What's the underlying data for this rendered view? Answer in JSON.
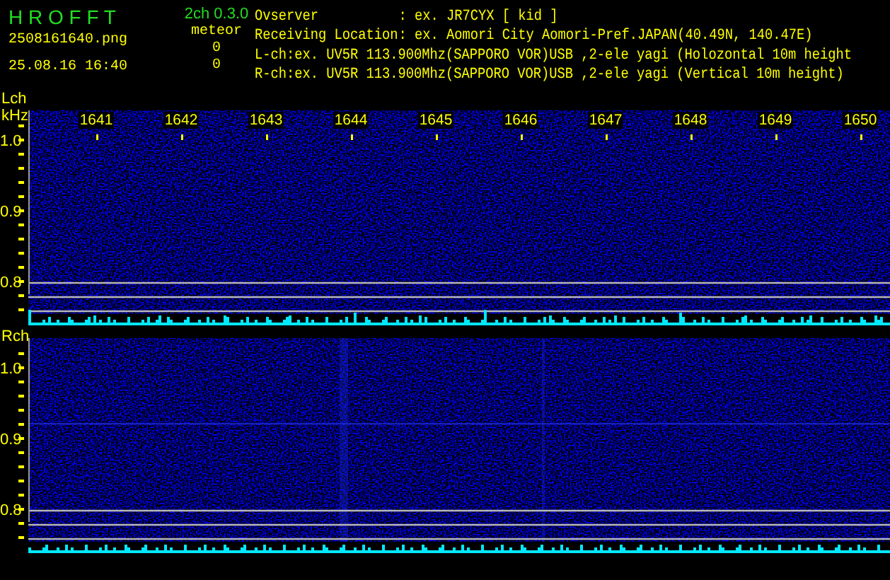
{
  "app": {
    "logo": "H R O F F T",
    "version": "2ch 0.3.0",
    "file": "2508161640.png",
    "datetime": "25.08.16 16:40"
  },
  "meteor": {
    "label": "meteor",
    "counts": [
      "0",
      "0"
    ]
  },
  "info": [
    {
      "label": "Ovserver",
      "value": ": ex. JR7CYX [ kid ]"
    },
    {
      "label": "Receiving Location",
      "value": ": ex. Aomori City Aomori-Pref.JAPAN(40.49N, 140.47E)"
    },
    {
      "label": "L-ch:",
      "value": "ex. UV5R 113.900Mhz(SAPPORO VOR)USB ,2-ele yagi (Holozontal 10m height"
    },
    {
      "label": "R-ch:",
      "value": "ex. UV5R 113.900Mhz(SAPPORO VOR)USB ,2-ele yagi (Vertical 10m height)"
    }
  ],
  "channels": [
    {
      "label": "Lch",
      "unit": "kHz",
      "x_ticks": [
        "1641",
        "1642",
        "1643",
        "1644",
        "1645",
        "1646",
        "1647",
        "1648",
        "1649",
        "1650"
      ],
      "y_ticks": [
        "1.0",
        "0.9",
        "0.8"
      ]
    },
    {
      "label": "Rch",
      "y_ticks": [
        "1.0",
        "0.9",
        "0.8"
      ]
    }
  ]
}
